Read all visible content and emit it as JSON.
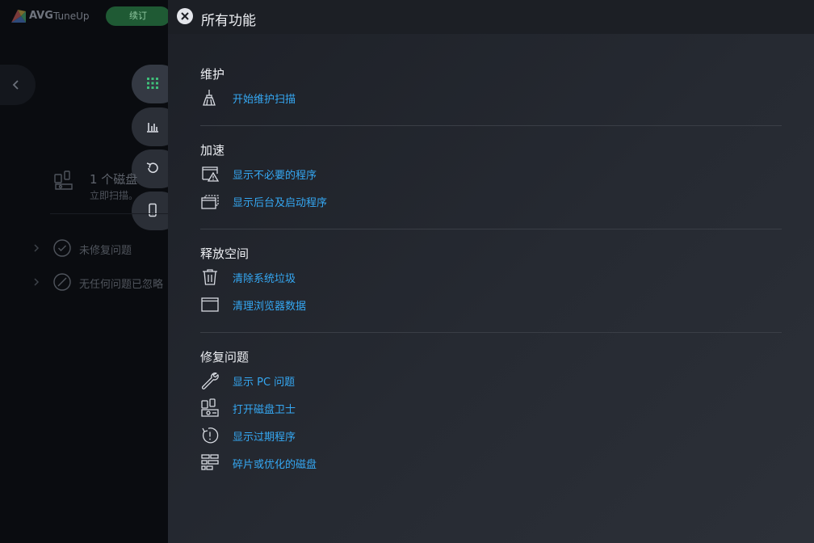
{
  "background_app": {
    "brand": "AVG",
    "product": "TuneUp",
    "renew_label": "续订",
    "disk_title": "1 个磁盘",
    "disk_subtitle": "立即扫描。",
    "rows": [
      {
        "label": "未修复问题"
      },
      {
        "label": "无任何问题已忽略"
      }
    ]
  },
  "panel": {
    "title": "所有功能",
    "sections": [
      {
        "title": "维护",
        "items": [
          {
            "icon": "broom-icon",
            "label": "开始维护扫描"
          }
        ]
      },
      {
        "title": "加速",
        "items": [
          {
            "icon": "window-warning-icon",
            "label": "显示不必要的程序"
          },
          {
            "icon": "stacked-windows-icon",
            "label": "显示后台及启动程序"
          }
        ]
      },
      {
        "title": "释放空间",
        "items": [
          {
            "icon": "trash-icon",
            "label": "清除系统垃圾"
          },
          {
            "icon": "browser-window-icon",
            "label": "清理浏览器数据"
          }
        ]
      },
      {
        "title": "修复问题",
        "items": [
          {
            "icon": "wrench-icon",
            "label": "显示 PC 问题"
          },
          {
            "icon": "disk-doctor-icon",
            "label": "打开磁盘卫士"
          },
          {
            "icon": "clock-alert-icon",
            "label": "显示过期程序"
          },
          {
            "icon": "defrag-icon",
            "label": "碎片或优化的磁盘"
          }
        ]
      }
    ]
  },
  "colors": {
    "link": "#35a8f3",
    "renew": "#1f5a34",
    "active_nav": "#3fbf7a"
  }
}
